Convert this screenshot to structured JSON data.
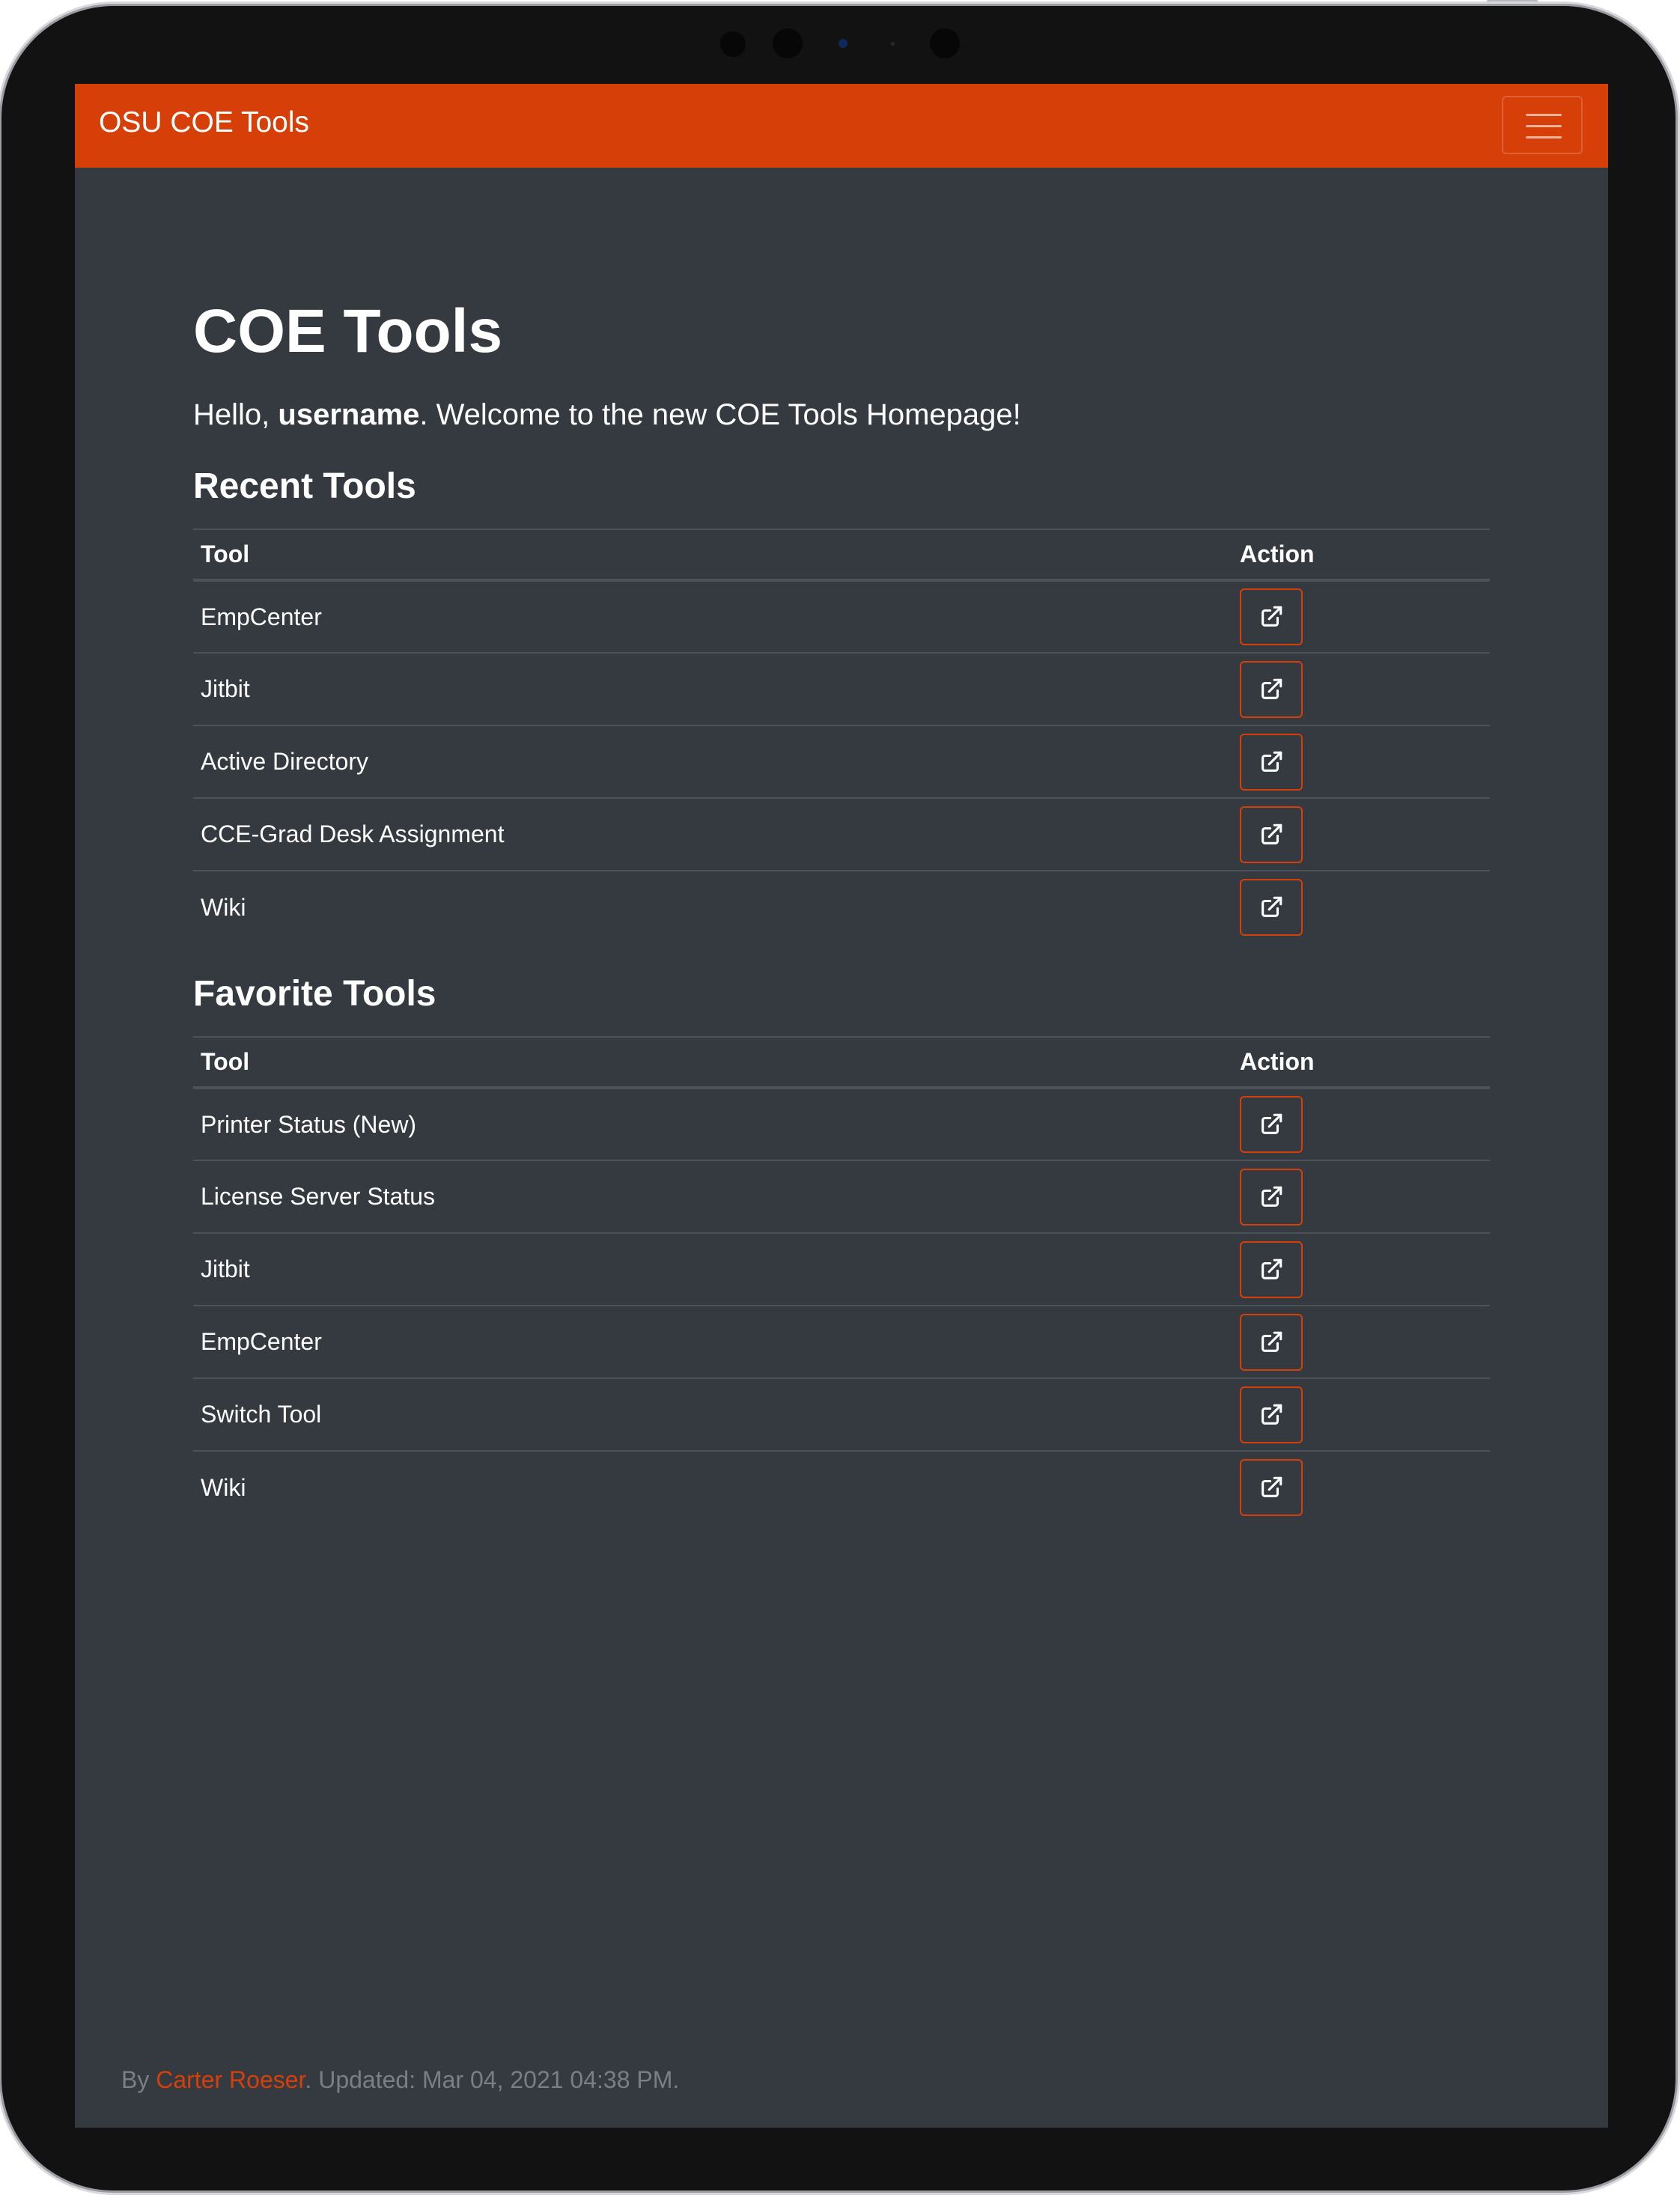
{
  "navbar": {
    "brand": "OSU COE Tools",
    "toggler_icon": "hamburger-menu-icon",
    "color": "#d73f09"
  },
  "page": {
    "title": "COE Tools",
    "greeting_prefix": "Hello, ",
    "username": "username",
    "greeting_suffix": ". Welcome to the new COE Tools Homepage!"
  },
  "recent": {
    "heading": "Recent Tools",
    "columns": {
      "tool": "Tool",
      "action": "Action"
    },
    "rows": [
      {
        "name": "EmpCenter",
        "icon": "external-link-icon"
      },
      {
        "name": "Jitbit",
        "icon": "external-link-icon"
      },
      {
        "name": "Active Directory",
        "icon": "external-link-icon"
      },
      {
        "name": "CCE-Grad Desk Assignment",
        "icon": "external-link-icon"
      },
      {
        "name": "Wiki",
        "icon": "external-link-icon"
      }
    ]
  },
  "favorites": {
    "heading": "Favorite Tools",
    "columns": {
      "tool": "Tool",
      "action": "Action"
    },
    "rows": [
      {
        "name": "Printer Status (New)",
        "icon": "external-link-icon"
      },
      {
        "name": "License Server Status",
        "icon": "external-link-icon"
      },
      {
        "name": "Jitbit",
        "icon": "external-link-icon"
      },
      {
        "name": "EmpCenter",
        "icon": "external-link-icon"
      },
      {
        "name": "Switch Tool",
        "icon": "external-link-icon"
      },
      {
        "name": "Wiki",
        "icon": "external-link-icon"
      }
    ]
  },
  "footer": {
    "prefix": "By ",
    "author": "Carter Roeser",
    "suffix": ". Updated: Mar 04, 2021 04:38 PM."
  },
  "colors": {
    "background": "#343a40",
    "accent": "#d73f09",
    "text": "#ffffff",
    "muted": "#7a7f85"
  }
}
